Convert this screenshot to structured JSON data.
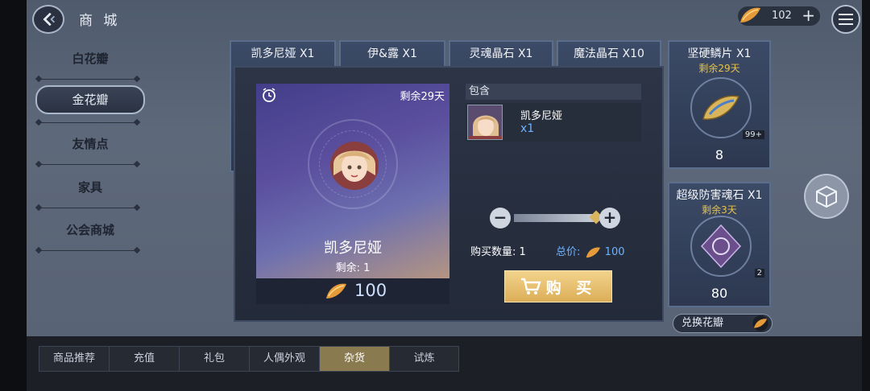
{
  "header": {
    "title": "商 城",
    "currency_amount": "102",
    "currency_icon": "petal-icon",
    "add_label": "+"
  },
  "categories": [
    {
      "label": "白花瓣",
      "active": false
    },
    {
      "label": "金花瓣",
      "active": true
    },
    {
      "label": "友情点",
      "active": false
    },
    {
      "label": "家具",
      "active": false
    },
    {
      "label": "公会商城",
      "active": false
    }
  ],
  "cards": [
    {
      "name": "凯多尼娅 X1"
    },
    {
      "name": "伊&露 X1"
    },
    {
      "name": "灵魂晶石 X1"
    },
    {
      "name": "魔法晶石 X10"
    },
    {
      "name": "坚硬鳞片 X1",
      "days": "剩余29天",
      "badge": "99+",
      "price": "8"
    },
    {
      "name": "超级防害魂石 X1",
      "days": "剩余3天",
      "badge": "2",
      "price": "80"
    }
  ],
  "exchange_label": "兑换花瓣",
  "modal": {
    "remaining_days": "剩余29天",
    "item_name": "凯多尼娅",
    "stock": "剩余: 1",
    "price": "100",
    "contents_header": "包含",
    "content_item": {
      "name": "凯多尼娅",
      "qty": "x1"
    },
    "quantity_label": "购买数量: 1",
    "total_label": "总价:",
    "total_value": "100",
    "buy_label": "购 买",
    "minus_label": "−",
    "plus_label": "+",
    "quantity_fraction": 1.0
  },
  "tabs": [
    {
      "label": "商品推荐",
      "active": false
    },
    {
      "label": "充值",
      "active": false
    },
    {
      "label": "礼包",
      "active": false
    },
    {
      "label": "人偶外观",
      "active": false
    },
    {
      "label": "杂货",
      "active": true
    },
    {
      "label": "试炼",
      "active": false
    }
  ],
  "colors": {
    "accent_gold": "#e8c24a",
    "price_blue": "#6fb3ff",
    "buy_button": "#e6bd68",
    "active_tab": "#8a7a50"
  }
}
